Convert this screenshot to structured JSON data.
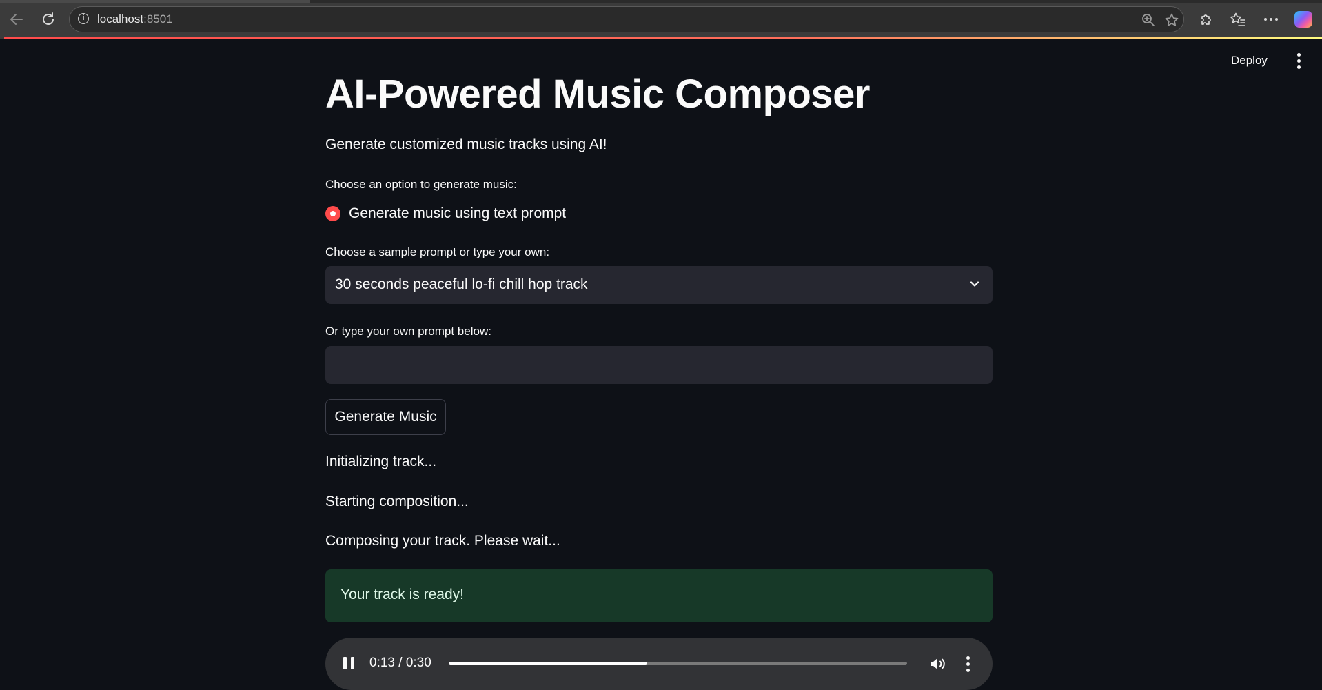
{
  "browser": {
    "url_host": "localhost",
    "url_port": ":8501"
  },
  "app_header": {
    "deploy_label": "Deploy"
  },
  "main": {
    "title": "AI-Powered Music Composer",
    "subtitle": "Generate customized music tracks using AI!",
    "option_label": "Choose an option to generate music:",
    "radio_options": [
      {
        "label": "Generate music using text prompt",
        "selected": true
      }
    ],
    "sample_prompt_label": "Choose a sample prompt or type your own:",
    "sample_prompt_selected": "30 seconds peaceful lo-fi chill hop track",
    "custom_prompt_label": "Or type your own prompt below:",
    "custom_prompt_value": "",
    "generate_button_label": "Generate Music",
    "status_messages": [
      "Initializing track...",
      "Starting composition...",
      "Composing your track. Please wait..."
    ],
    "success_message": "Your track is ready!"
  },
  "audio_player": {
    "time_display": "0:13 / 0:30",
    "progress_fraction": 0.4333
  },
  "colors": {
    "accent": "#ff4b4b",
    "background": "#0e1117",
    "input_background": "#262730",
    "success_background": "#173928"
  }
}
